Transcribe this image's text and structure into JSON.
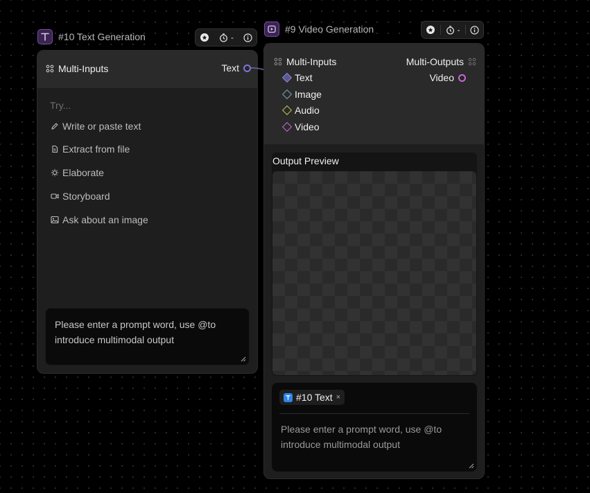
{
  "text_node": {
    "title": "#10 Text Generation",
    "toolbar": {
      "timer_value": "-"
    },
    "inputs_label": "Multi-Inputs",
    "output_port_label": "Text",
    "try_label": "Try...",
    "suggestions": [
      {
        "label": "Write or paste text",
        "icon": "pencil-icon"
      },
      {
        "label": "Extract from file",
        "icon": "file-icon"
      },
      {
        "label": "Elaborate",
        "icon": "bulb-icon"
      },
      {
        "label": "Storyboard",
        "icon": "video-camera-icon"
      },
      {
        "label": "Ask about an image",
        "icon": "image-icon"
      }
    ],
    "prompt_placeholder": "Please enter a prompt word, use @to introduce multimodal output"
  },
  "video_node": {
    "title": "#9 Video Generation",
    "toolbar": {
      "timer_value": "-"
    },
    "inputs_label": "Multi-Inputs",
    "outputs_label": "Multi-Outputs",
    "inputs": [
      {
        "label": "Text",
        "color": "#8b86d6"
      },
      {
        "label": "Image",
        "color": "#7aa3b0"
      },
      {
        "label": "Audio",
        "color": "#b6c848"
      },
      {
        "label": "Video",
        "color": "#c46ad6"
      }
    ],
    "output_port_label": "Video",
    "output_port_color": "#c46ad6",
    "preview_label": "Output Preview",
    "chip_label": "#10 Text",
    "chip_close": "×",
    "prompt_placeholder": "Please enter a prompt word, use @to introduce multimodal output"
  }
}
